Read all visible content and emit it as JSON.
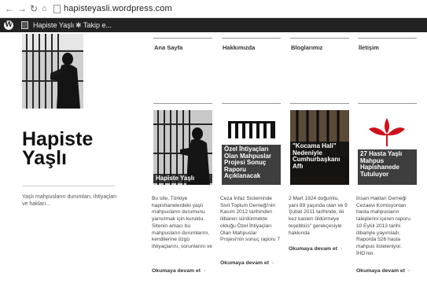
{
  "browser": {
    "url": "hapisteyasli.wordpress.com",
    "back_icon": "back-arrow-icon",
    "forward_icon": "forward-arrow-icon",
    "reload_icon": "reload-icon",
    "home_icon": "home-icon"
  },
  "admin_bar": {
    "site_name": "Hapiste Yaşlı",
    "follow_label": "Takip e..."
  },
  "site": {
    "title": "Hapiste Yaşlı",
    "tagline": "Yaşlı mahpusların durumları, ihtiyaçları ve hakları..."
  },
  "menu": {
    "items": [
      {
        "label": "Ana Sayfa"
      },
      {
        "label": "Hakkımızda"
      },
      {
        "label": "Bloglarımız"
      },
      {
        "label": "İletişim"
      }
    ]
  },
  "posts": [
    {
      "caption": "Hapiste Yaşlı",
      "excerpt": "Bu site, Türkiye hapishanelerdeki yaşlı mahpusların durumunu yansıtmak için kuruldu. Sitenin amacı bu mahpusların durumlarını, kendilerine özgü ihtiyaçlarını, sorunlarını ve",
      "more": "Okumaya devam et"
    },
    {
      "caption": "Özel İhtiyaçları Olan Mahpuslar Projesi Sonuç Raporu Açıklanacak",
      "excerpt": "Ceza İnfaz Sisteminde Sivil Toplum Derneği'nin Kasım 2012 tarihinden itibaren sürdürmekte olduğu Özel İhtiyaçları Olan Mahpuslar Projesi'nin sonuç raporu 7",
      "more": "Okumaya devam et"
    },
    {
      "caption": "\"Kocama Hali\" Nedeniyle Cumhurbaşkanı Affı",
      "excerpt": "2 Mart 1924 doğumlu, yani 89 yaşında olan ve 9 Şubat 2011 tarihinde, iki kez kasten öldürmeye teşebbüs\" gerekçesiyle hakkında",
      "more": "Okumaya devam et"
    },
    {
      "caption": "27 Hasta Yaşlı Mahpus Hapishanede Tutuluyor",
      "excerpt": "İnsan Hakları Derneği Cezaevi Komisyonları hasta mahpusların taleplerini içeren raporu 10 Eylül 2013 tarihi itibariyle yayımladı. Raporda 526 hasta mahpus listeleniyor. İHD'nin",
      "more": "Okumaya devam et"
    }
  ],
  "colors": {
    "admin_bar": "#222222",
    "page_background": "#f2f2f2",
    "logo_red": "#d0101a"
  }
}
